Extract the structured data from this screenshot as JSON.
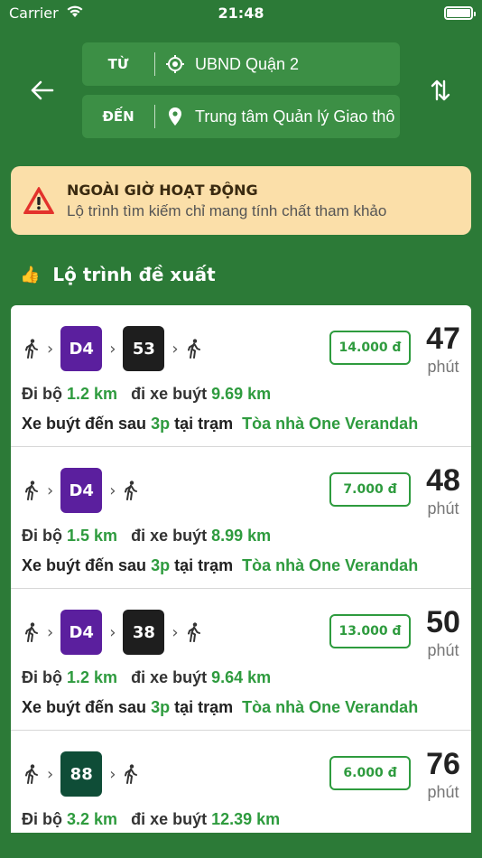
{
  "status_bar": {
    "carrier": "Carrier",
    "time": "21:48"
  },
  "search": {
    "from_label": "TỪ",
    "from_value": "UBND Quận 2",
    "to_label": "ĐẾN",
    "to_value": "Trung tâm Quản lý Giao thô"
  },
  "warning": {
    "title": "NGOÀI GIỜ HOẠT ĐỘNG",
    "subtitle": "Lộ trình tìm kiếm chỉ mang tính chất tham khảo"
  },
  "section": {
    "title": "Lộ trình đề xuất"
  },
  "labels": {
    "walk": "Đi bộ",
    "bus": "đi xe buýt",
    "arrive_prefix": "Xe buýt đến sau",
    "at_station": "tại trạm",
    "minutes": "phút"
  },
  "routes": [
    {
      "buses": [
        {
          "line": "D4",
          "color": "#5b1f9e"
        },
        {
          "line": "53",
          "color": "#1e1e1e"
        }
      ],
      "price": "14.000 đ",
      "duration": "47",
      "walk_km": "1.2 km",
      "bus_km": "9.69 km",
      "arrive_in": "3p",
      "station": "Tòa nhà One Verandah"
    },
    {
      "buses": [
        {
          "line": "D4",
          "color": "#5b1f9e"
        }
      ],
      "price": "7.000 đ",
      "duration": "48",
      "walk_km": "1.5 km",
      "bus_km": "8.99 km",
      "arrive_in": "3p",
      "station": "Tòa nhà One Verandah"
    },
    {
      "buses": [
        {
          "line": "D4",
          "color": "#5b1f9e"
        },
        {
          "line": "38",
          "color": "#1e1e1e"
        }
      ],
      "price": "13.000 đ",
      "duration": "50",
      "walk_km": "1.2 km",
      "bus_km": "9.64 km",
      "arrive_in": "3p",
      "station": "Tòa nhà One Verandah"
    },
    {
      "buses": [
        {
          "line": "88",
          "color": "#0f4d37"
        }
      ],
      "price": "6.000 đ",
      "duration": "76",
      "walk_km": "3.2 km",
      "bus_km": "12.39 km",
      "arrive_in": "",
      "station": ""
    }
  ],
  "icons": {
    "back": "arrow-left-icon",
    "swap": "swap-vertical-icon",
    "origin": "crosshair-location-icon",
    "destination": "map-pin-icon",
    "warning": "warning-triangle-icon",
    "thumb": "thumbs-up-icon",
    "walk": "walking-person-icon"
  },
  "colors": {
    "background": "#2c7a37",
    "accent": "#2e9b3e",
    "warning_bg": "#fbdfa9"
  }
}
